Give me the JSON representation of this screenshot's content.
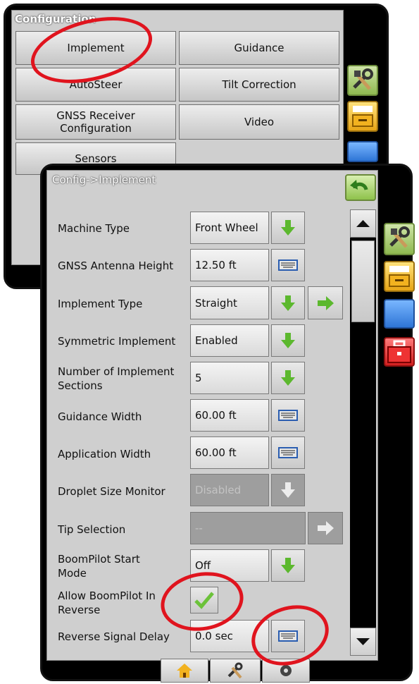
{
  "config_panel": {
    "title": "Configuration",
    "buttons": [
      "Implement",
      "Guidance",
      "AutoSteer",
      "Tilt Correction",
      "GNSS Receiver Configuration",
      "Video",
      "Sensors"
    ]
  },
  "implement_panel": {
    "title": "Config->Implement",
    "rows": [
      {
        "label": "Machine Type",
        "value": "Front Wheel"
      },
      {
        "label": "GNSS Antenna Height",
        "value": "12.50 ft"
      },
      {
        "label": "Implement Type",
        "value": "Straight"
      },
      {
        "label": "Symmetric Implement",
        "value": "Enabled"
      },
      {
        "label": "Number of Implement Sections",
        "value": "5"
      },
      {
        "label": "Guidance Width",
        "value": "60.00 ft"
      },
      {
        "label": "Application Width",
        "value": "60.00 ft"
      },
      {
        "label": "Droplet Size Monitor",
        "value": "Disabled"
      },
      {
        "label": "Tip Selection",
        "value": "--"
      },
      {
        "label": "BoomPilot Start Mode",
        "value": "Off"
      },
      {
        "label": "Allow BoomPilot In Reverse",
        "value": "checked"
      },
      {
        "label": "Reverse Signal Delay",
        "value": "0.0 sec"
      }
    ]
  },
  "icons": [
    "tools-icon",
    "card-icon",
    "blue-screen-icon",
    "toolbox-icon",
    "home-icon",
    "camera-icon",
    "back-arrow-icon",
    "keyboard-icon",
    "down-arrow-icon",
    "right-arrow-icon",
    "checkmark-icon"
  ],
  "colors": {
    "highlight": "#e0141e",
    "green_arrow": "#5cb82e"
  }
}
